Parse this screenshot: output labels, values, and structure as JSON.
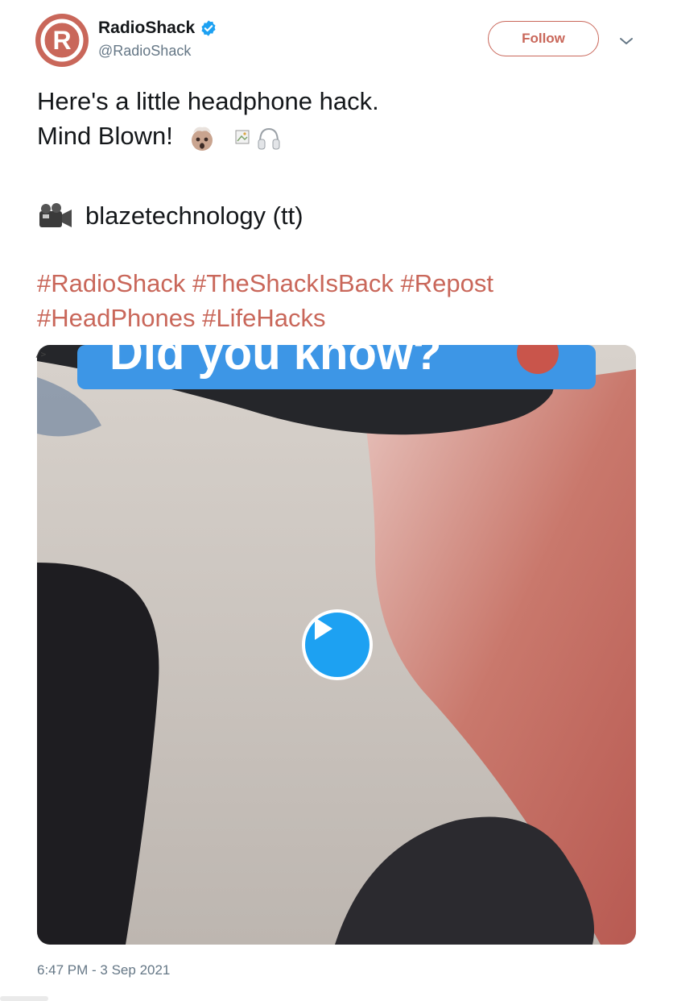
{
  "author": {
    "display_name": "RadioShack",
    "handle": "@RadioShack",
    "verified": true,
    "avatar_icon": "radioshack-logo",
    "avatar_letter": "R"
  },
  "actions": {
    "follow_label": "Follow",
    "more_icon": "chevron-down-icon"
  },
  "tweet": {
    "line1": "Here's a little headphone hack.",
    "line2": "Mind Blown!",
    "line2_emojis": [
      "exploding-head-emoji",
      "broken-image-icon",
      "headphone-icon"
    ],
    "credit_icon": "video-camera-emoji",
    "credit": "blazetechnology (tt)",
    "hashtags": [
      "#RadioShack",
      "#TheShackIsBack",
      "#Repost",
      "#HeadPhones",
      "#LifeHacks"
    ]
  },
  "media": {
    "broken_markup": "/>",
    "banner_text": "Did you know?",
    "play_icon": "play-icon"
  },
  "timestamp": "6:47 PM - 3 Sep 2021",
  "colors": {
    "brand": "#c9675a",
    "verified": "#1da1f2",
    "play": "#1da1f2",
    "muted": "#657786"
  }
}
